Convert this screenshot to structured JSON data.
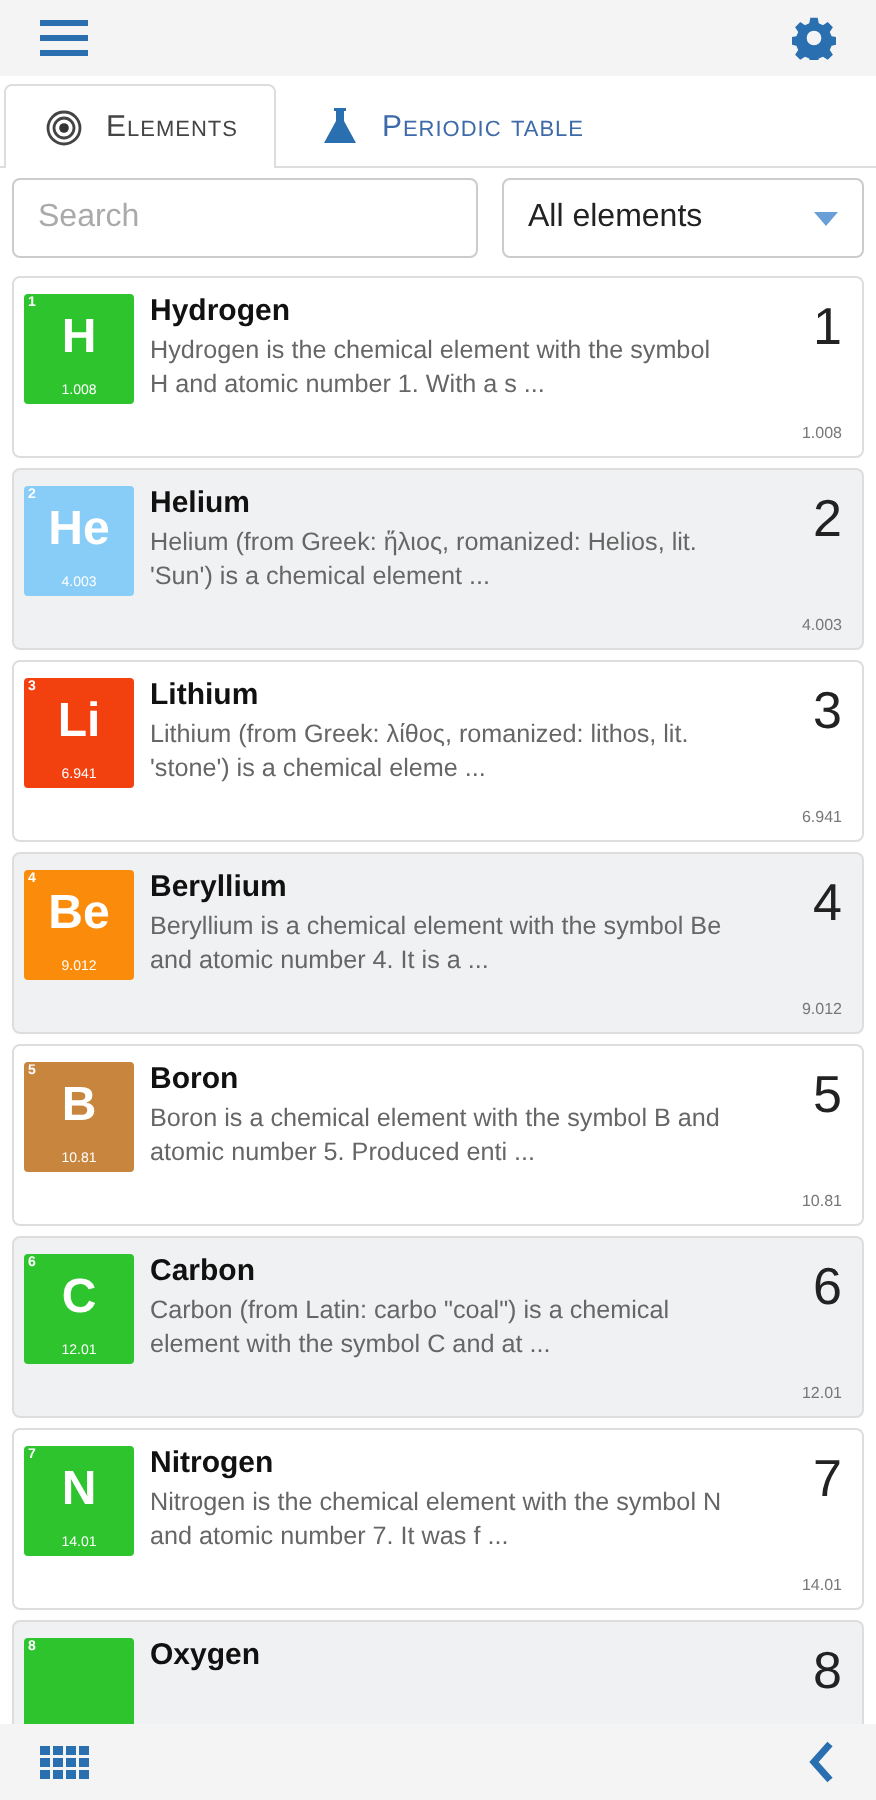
{
  "tabs": [
    {
      "label": "Elements",
      "selected": true
    },
    {
      "label": "Periodic table",
      "selected": false
    }
  ],
  "search": {
    "placeholder": "Search"
  },
  "filter": {
    "value": "All elements"
  },
  "elements": [
    {
      "tile_number": "1",
      "symbol": "H",
      "tile_mass": "1.008",
      "name": "Hydrogen",
      "number": "1",
      "mass": "1.008",
      "color": "#2ec42e",
      "description": "Hydrogen is the chemical element with the symbol H and atomic number 1. With a s ..."
    },
    {
      "tile_number": "2",
      "symbol": "He",
      "tile_mass": "4.003",
      "name": "Helium",
      "number": "2",
      "mass": "4.003",
      "color": "#87cdf7",
      "description": "Helium (from Greek: ἥλιος, romanized: Helios, lit. 'Sun') is a chemical element ..."
    },
    {
      "tile_number": "3",
      "symbol": "Li",
      "tile_mass": "6.941",
      "name": "Lithium",
      "number": "3",
      "mass": "6.941",
      "color": "#f2410f",
      "description": "Lithium (from Greek: λίθος, romanized: lithos, lit. 'stone') is a chemical eleme ..."
    },
    {
      "tile_number": "4",
      "symbol": "Be",
      "tile_mass": "9.012",
      "name": "Beryllium",
      "number": "4",
      "mass": "9.012",
      "color": "#fb8b0a",
      "description": "Beryllium is a chemical element with the symbol Be and atomic number 4. It is a ..."
    },
    {
      "tile_number": "5",
      "symbol": "B",
      "tile_mass": "10.81",
      "name": "Boron",
      "number": "5",
      "mass": "10.81",
      "color": "#c8853e",
      "description": "Boron is a chemical element with the symbol B and atomic number 5. Produced enti ..."
    },
    {
      "tile_number": "6",
      "symbol": "C",
      "tile_mass": "12.01",
      "name": "Carbon",
      "number": "6",
      "mass": "12.01",
      "color": "#2ec42e",
      "description": "Carbon (from Latin: carbo \"coal\") is a chemical element with the symbol C and at ..."
    },
    {
      "tile_number": "7",
      "symbol": "N",
      "tile_mass": "14.01",
      "name": "Nitrogen",
      "number": "7",
      "mass": "14.01",
      "color": "#2ec42e",
      "description": "Nitrogen is the chemical element with the symbol N and atomic number 7. It was f ..."
    },
    {
      "tile_number": "8",
      "name": "Oxygen",
      "number": "8",
      "color": "#2ec42e"
    }
  ]
}
